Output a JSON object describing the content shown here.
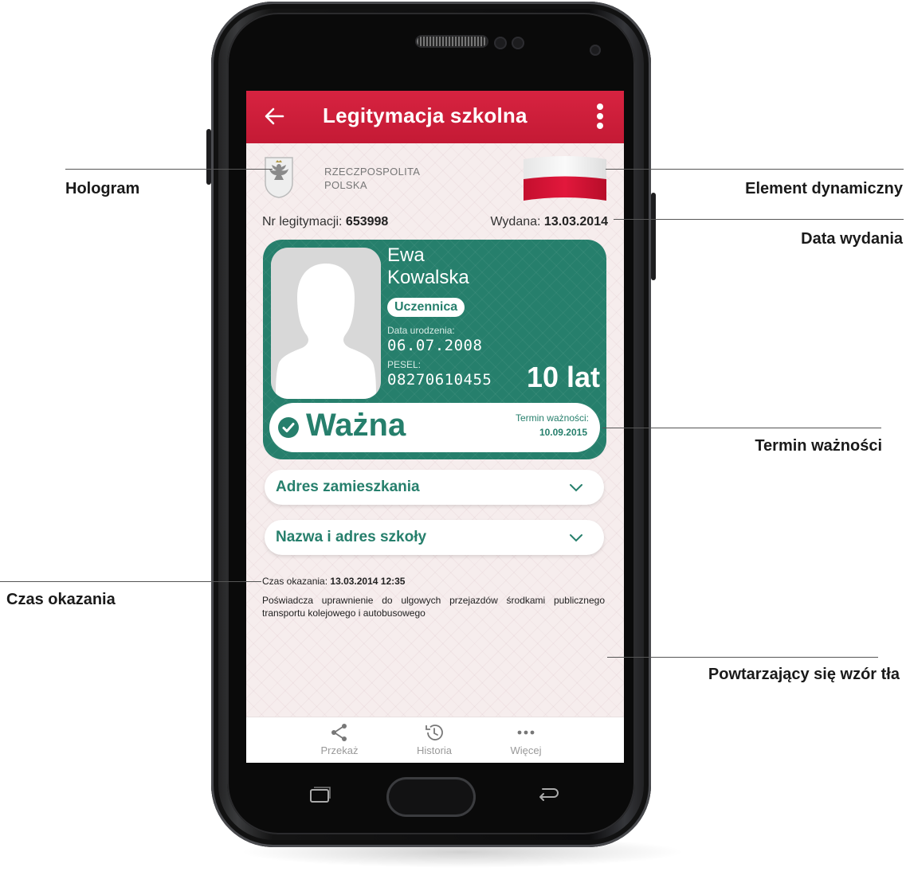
{
  "app": {
    "title": "Legitymacja szkolna"
  },
  "header": {
    "country_line1": "RZECZPOSPOLITA",
    "country_line2": "POLSKA"
  },
  "document": {
    "nr_label": "Nr legitymacji:",
    "nr_value": "653998",
    "issued_label": "Wydana:",
    "issued_value": "13.03.2014"
  },
  "card": {
    "first_name": "Ewa",
    "last_name": "Kowalska",
    "role": "Uczennica",
    "dob_label": "Data urodzenia:",
    "dob_value": "06.07.2008",
    "pesel_label": "PESEL:",
    "pesel_value": "08270610455",
    "age": "10 lat",
    "status": "Ważna",
    "expiry_label": "Termin ważności:",
    "expiry_value": "10.09.2015",
    "color": "#267f6c"
  },
  "accordions": [
    {
      "label": "Adres zamieszkania",
      "icon": "chevron-down-icon"
    },
    {
      "label": "Nazwa i adres szkoły",
      "icon": "chevron-down-icon"
    }
  ],
  "footer_info": {
    "shown_label": "Czas okazania:",
    "shown_value": "13.03.2014 12:35",
    "legal_text": "Poświadcza uprawnienie do ulgowych przejazdów środkami publicznego transportu kolejowego i autobusowego"
  },
  "bottom_nav": [
    {
      "label": "Przekaż",
      "icon": "share-icon"
    },
    {
      "label": "Historia",
      "icon": "history-icon"
    },
    {
      "label": "Więcej",
      "icon": "more-horizontal-icon"
    }
  ],
  "annotations": {
    "hologram": "Hologram",
    "dynamic_element": "Element dynamiczny",
    "issue_date": "Data wydania",
    "expiry": "Termin ważności",
    "shown_time": "Czas okazania",
    "background_pattern": "Powtarzający się wzór tła"
  },
  "colors": {
    "appbar": "#d72340",
    "accent_green": "#267f6c",
    "flag_red": "#dc143c"
  }
}
